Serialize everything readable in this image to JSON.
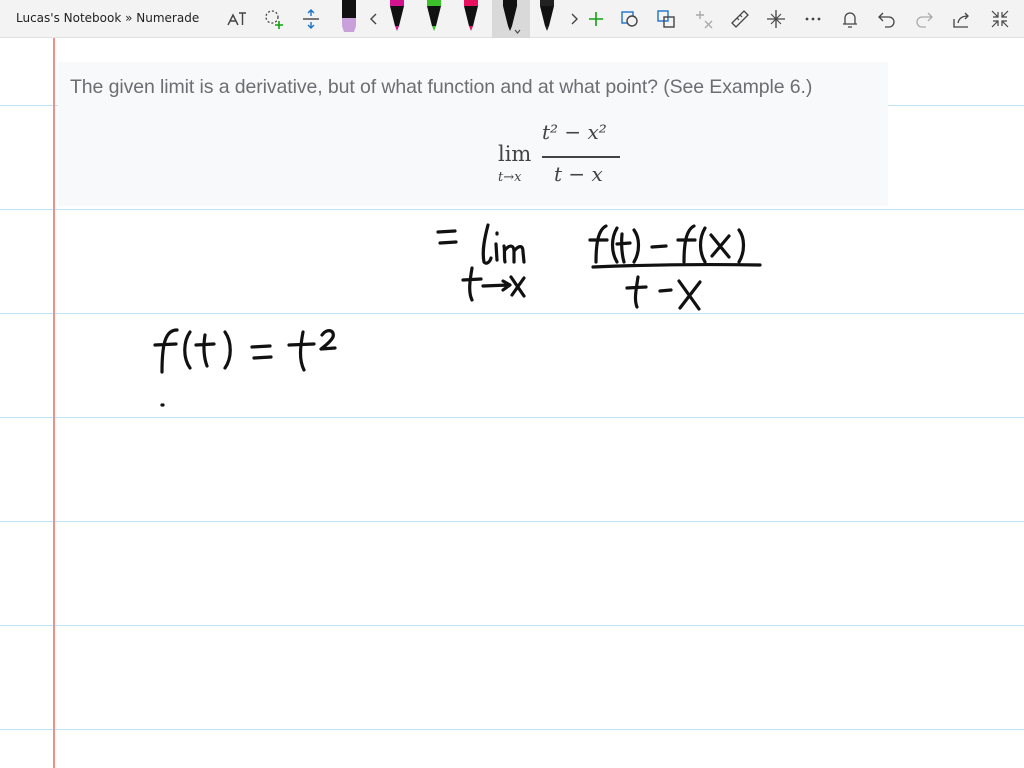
{
  "window": {
    "title": "Lucas's Notebook » Numerade"
  },
  "toolbar": {
    "icons": [
      "text-to-ink-icon",
      "lasso-add-icon",
      "insert-space-icon",
      "chevron-left-icon",
      "chevron-right-icon",
      "add-pen-icon",
      "shape-icon",
      "convert-icon",
      "math-icon",
      "ruler-icon",
      "stencil-icon",
      "more-icon",
      "notification-icon",
      "undo-icon",
      "redo-icon",
      "share-icon",
      "fullscreen-icon"
    ],
    "pens": [
      {
        "name": "black-highlighter",
        "color": "#111111",
        "band": "#c9a0dc"
      },
      {
        "name": "magenta-pen",
        "color": "#111111",
        "band": "#d4138f"
      },
      {
        "name": "green-pen",
        "color": "#111111",
        "band": "#3bbf2a"
      },
      {
        "name": "pink-pen",
        "color": "#111111",
        "band": "#e8105f"
      },
      {
        "name": "black-pen-selected",
        "color": "#111111",
        "band": "#111111"
      },
      {
        "name": "black-pen-2",
        "color": "#111111",
        "band": "#222222"
      }
    ]
  },
  "question": {
    "text": "The given limit is a derivative, but of what function and at what point? (See Example 6.)",
    "formula": {
      "lim": "lim",
      "subscript": "t→x",
      "numerator": "t² − x²",
      "denominator": "t − x"
    }
  },
  "colors": {
    "rule_line": "#bfe3f3",
    "margin_line": "#f08f8f",
    "ink": "#111111"
  }
}
